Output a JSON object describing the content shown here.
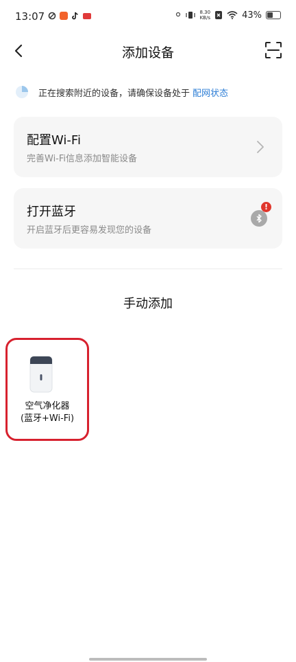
{
  "status_bar": {
    "time": "13:07",
    "net_speed_value": "8.30",
    "net_speed_unit": "KB/s",
    "battery": "43%"
  },
  "header": {
    "title": "添加设备"
  },
  "search_status": {
    "text": "正在搜索附近的设备，请确保设备处于",
    "link": "配网状态"
  },
  "wifi_card": {
    "title": "配置Wi-Fi",
    "subtitle": "完善Wi-Fi信息添加智能设备"
  },
  "bluetooth_card": {
    "title": "打开蓝牙",
    "subtitle": "开启蓝牙后更容易发现您的设备",
    "alert": "!"
  },
  "manual_section": {
    "title": "手动添加",
    "devices": [
      {
        "name_line1": "空气净化器",
        "name_line2": "(蓝牙+Wi-Fi)"
      }
    ]
  },
  "colors": {
    "accent_link": "#2f7fd6",
    "highlight_border": "#d7212e",
    "alert": "#e0362c"
  }
}
